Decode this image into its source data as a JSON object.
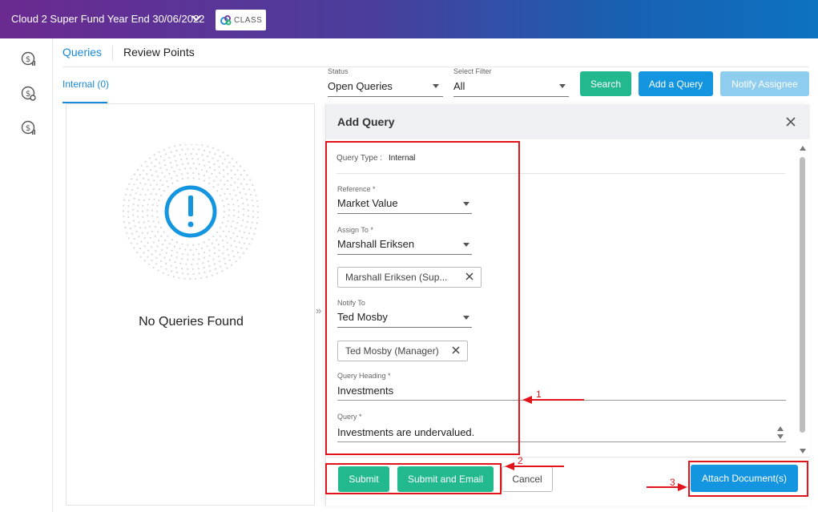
{
  "header": {
    "title": "Cloud 2 Super Fund Year End 30/06/2022",
    "logo_text": "CLASS"
  },
  "left_rail": {
    "icons": [
      "dollar-chart-icon",
      "dollar-gear-icon",
      "dollar-chart-icon"
    ]
  },
  "tabs": [
    {
      "label": "Queries",
      "active": true
    },
    {
      "label": "Review Points",
      "active": false
    }
  ],
  "subtab": {
    "label": "Internal (0)"
  },
  "filters": {
    "status": {
      "label": "Status",
      "value": "Open Queries"
    },
    "select_filter": {
      "label": "Select Filter",
      "value": "All"
    }
  },
  "toolbar": {
    "search_label": "Search",
    "add_query_label": "Add a Query",
    "notify_label": "Notify Assignee"
  },
  "empty_state": {
    "message": "No Queries Found"
  },
  "drawer": {
    "title": "Add Query",
    "query_type_label": "Query Type :",
    "query_type_value": "Internal",
    "reference": {
      "label": "Reference *",
      "value": "Market Value"
    },
    "assign_to": {
      "label": "Assign To *",
      "value": "Marshall Eriksen",
      "chip": "Marshall Eriksen (Sup..."
    },
    "notify_to": {
      "label": "Notify To",
      "value": "Ted Mosby",
      "chip": "Ted Mosby (Manager)"
    },
    "query_heading": {
      "label": "Query Heading *",
      "value": "Investments"
    },
    "query": {
      "label": "Query *",
      "value": "Investments are undervalued."
    },
    "buttons": {
      "submit": "Submit",
      "submit_email": "Submit and Email",
      "cancel": "Cancel",
      "attach": "Attach Document(s)"
    }
  },
  "annotations": {
    "n1": "1",
    "n2": "2",
    "n3": "3"
  },
  "colors": {
    "accent_blue": "#1495e0",
    "accent_green": "#22b98e",
    "annotation_red": "#e0141a"
  }
}
